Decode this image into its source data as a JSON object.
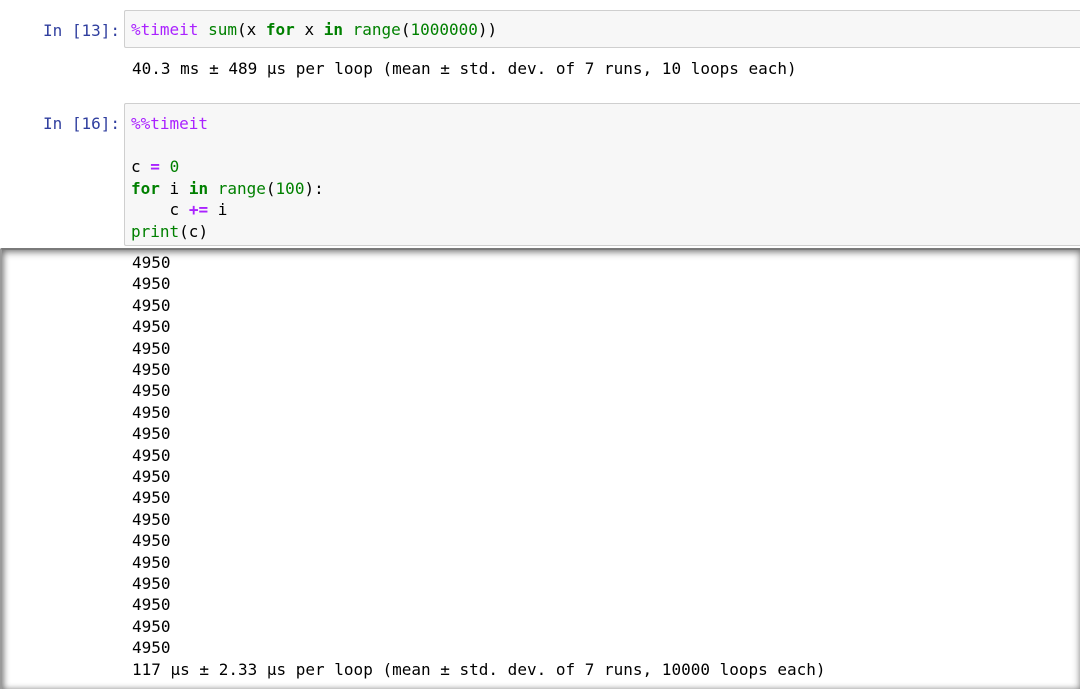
{
  "cell_13": {
    "prompt": "In [13]:",
    "code": {
      "magic": "%timeit",
      "builtin_sum": "sum",
      "paren_open": "(",
      "var_x": "x",
      "kw_for": "for",
      "var_x2": "x",
      "kw_in": "in",
      "builtin_range": "range",
      "paren_open2": "(",
      "number": "1000000",
      "paren_close": "))"
    },
    "output": "40.3 ms ± 489 µs per loop (mean ± std. dev. of 7 runs, 10 loops each)"
  },
  "cell_16": {
    "prompt": "In [16]:",
    "code": {
      "line1_magic": "%%timeit",
      "line3_var": "c",
      "line3_op": "=",
      "line3_num": "0",
      "line4_kw_for": "for",
      "line4_var": "i",
      "line4_kw_in": "in",
      "line4_builtin": "range",
      "line4_paren_open": "(",
      "line4_num": "100",
      "line4_tail": "):",
      "line5_var": "c",
      "line5_op": "+=",
      "line5_var2": "i",
      "line6_builtin": "print",
      "line6_args": "(c)"
    },
    "output_lines": [
      "4950",
      "4950",
      "4950",
      "4950",
      "4950",
      "4950",
      "4950",
      "4950",
      "4950",
      "4950",
      "4950",
      "4950",
      "4950",
      "4950",
      "4950",
      "4950",
      "4950",
      "4950",
      "4950"
    ],
    "timing": "117 µs ± 2.33 µs per loop (mean ± std. dev. of 7 runs, 10000 loops each)"
  },
  "colors": {
    "prompt": "#303f9f",
    "keyword": "#008000",
    "magic": "#aa22ff",
    "input_bg": "#f7f7f7",
    "input_border": "#cfcfcf"
  }
}
